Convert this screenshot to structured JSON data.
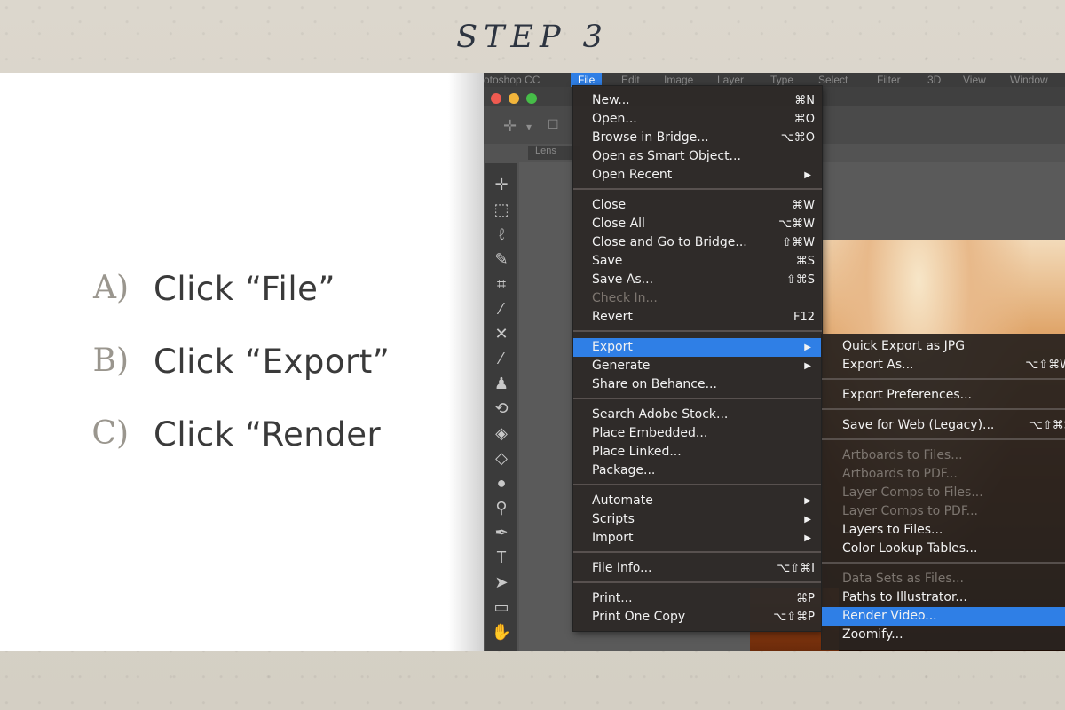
{
  "step_title": "STEP 3",
  "instructions": [
    {
      "letter": "A)",
      "text": "Click “File”"
    },
    {
      "letter": "B)",
      "text": "Click “Export”"
    },
    {
      "letter": "C)",
      "text": "Click “Render"
    }
  ],
  "app": {
    "menubar": {
      "app_name": "otoshop CC",
      "items": [
        "File",
        "Edit",
        "Image",
        "Layer",
        "Type",
        "Select",
        "Filter",
        "3D",
        "View",
        "Window"
      ]
    },
    "doc_tab": "Lens"
  },
  "file_menu": {
    "groups": [
      [
        {
          "label": "New...",
          "shortcut": "⌘N"
        },
        {
          "label": "Open...",
          "shortcut": "⌘O"
        },
        {
          "label": "Browse in Bridge...",
          "shortcut": "⌥⌘O"
        },
        {
          "label": "Open as Smart Object..."
        },
        {
          "label": "Open Recent",
          "arrow": "▶"
        }
      ],
      [
        {
          "label": "Close",
          "shortcut": "⌘W"
        },
        {
          "label": "Close All",
          "shortcut": "⌥⌘W"
        },
        {
          "label": "Close and Go to Bridge...",
          "shortcut": "⇧⌘W"
        },
        {
          "label": "Save",
          "shortcut": "⌘S"
        },
        {
          "label": "Save As...",
          "shortcut": "⇧⌘S"
        },
        {
          "label": "Check In...",
          "disabled": true
        },
        {
          "label": "Revert",
          "shortcut": "F12"
        }
      ],
      [
        {
          "label": "Export",
          "arrow": "▶",
          "highlighted": true
        },
        {
          "label": "Generate",
          "arrow": "▶"
        },
        {
          "label": "Share on Behance..."
        }
      ],
      [
        {
          "label": "Search Adobe Stock..."
        },
        {
          "label": "Place Embedded..."
        },
        {
          "label": "Place Linked..."
        },
        {
          "label": "Package..."
        }
      ],
      [
        {
          "label": "Automate",
          "arrow": "▶"
        },
        {
          "label": "Scripts",
          "arrow": "▶"
        },
        {
          "label": "Import",
          "arrow": "▶"
        }
      ],
      [
        {
          "label": "File Info...",
          "shortcut": "⌥⇧⌘I"
        }
      ],
      [
        {
          "label": "Print...",
          "shortcut": "⌘P"
        },
        {
          "label": "Print One Copy",
          "shortcut": "⌥⇧⌘P"
        }
      ]
    ]
  },
  "export_submenu": {
    "groups": [
      [
        {
          "label": "Quick Export as JPG"
        },
        {
          "label": "Export As...",
          "shortcut": "⌥⇧⌘W"
        }
      ],
      [
        {
          "label": "Export Preferences..."
        }
      ],
      [
        {
          "label": "Save for Web (Legacy)...",
          "shortcut": "⌥⇧⌘S"
        }
      ],
      [
        {
          "label": "Artboards to Files...",
          "disabled": true
        },
        {
          "label": "Artboards to PDF...",
          "disabled": true
        },
        {
          "label": "Layer Comps to Files...",
          "disabled": true
        },
        {
          "label": "Layer Comps to PDF...",
          "disabled": true
        },
        {
          "label": "Layers to Files..."
        },
        {
          "label": "Color Lookup Tables..."
        }
      ],
      [
        {
          "label": "Data Sets as Files...",
          "disabled": true
        },
        {
          "label": "Paths to Illustrator..."
        },
        {
          "label": "Render Video...",
          "highlighted": true
        },
        {
          "label": "Zoomify..."
        }
      ]
    ]
  },
  "colors": {
    "highlight": "#2f7fe6",
    "title": "#2d3440",
    "menu_bg": "#2e2a28"
  }
}
